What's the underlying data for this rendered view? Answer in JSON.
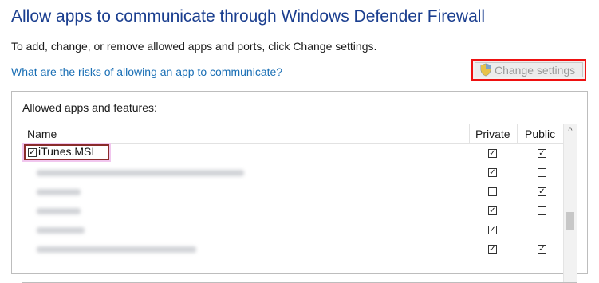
{
  "header": {
    "title": "Allow apps to communicate through Windows Defender Firewall",
    "description": "To add, change, or remove allowed apps and ports, click Change settings.",
    "risk_link": "What are the risks of allowing an app to communicate?"
  },
  "change_settings": {
    "label": "Change settings",
    "icon": "uac-shield-icon",
    "highlight_color": "#e11111"
  },
  "panel": {
    "label": "Allowed apps and features:",
    "columns": {
      "name": "Name",
      "private": "Private",
      "public": "Public"
    },
    "rows": [
      {
        "name": "iTunes.MSI",
        "checked": true,
        "private": true,
        "public": true
      },
      {
        "name": "",
        "checked": false,
        "private": true,
        "public": false
      },
      {
        "name": "",
        "checked": false,
        "private": false,
        "public": true
      },
      {
        "name": "",
        "checked": false,
        "private": true,
        "public": false
      },
      {
        "name": "",
        "checked": false,
        "private": true,
        "public": false
      },
      {
        "name": "",
        "checked": false,
        "private": true,
        "public": true
      }
    ]
  },
  "colors": {
    "title": "#1a3e8f",
    "link": "#1a6fb5",
    "row_highlight": "#8a2b2b"
  }
}
